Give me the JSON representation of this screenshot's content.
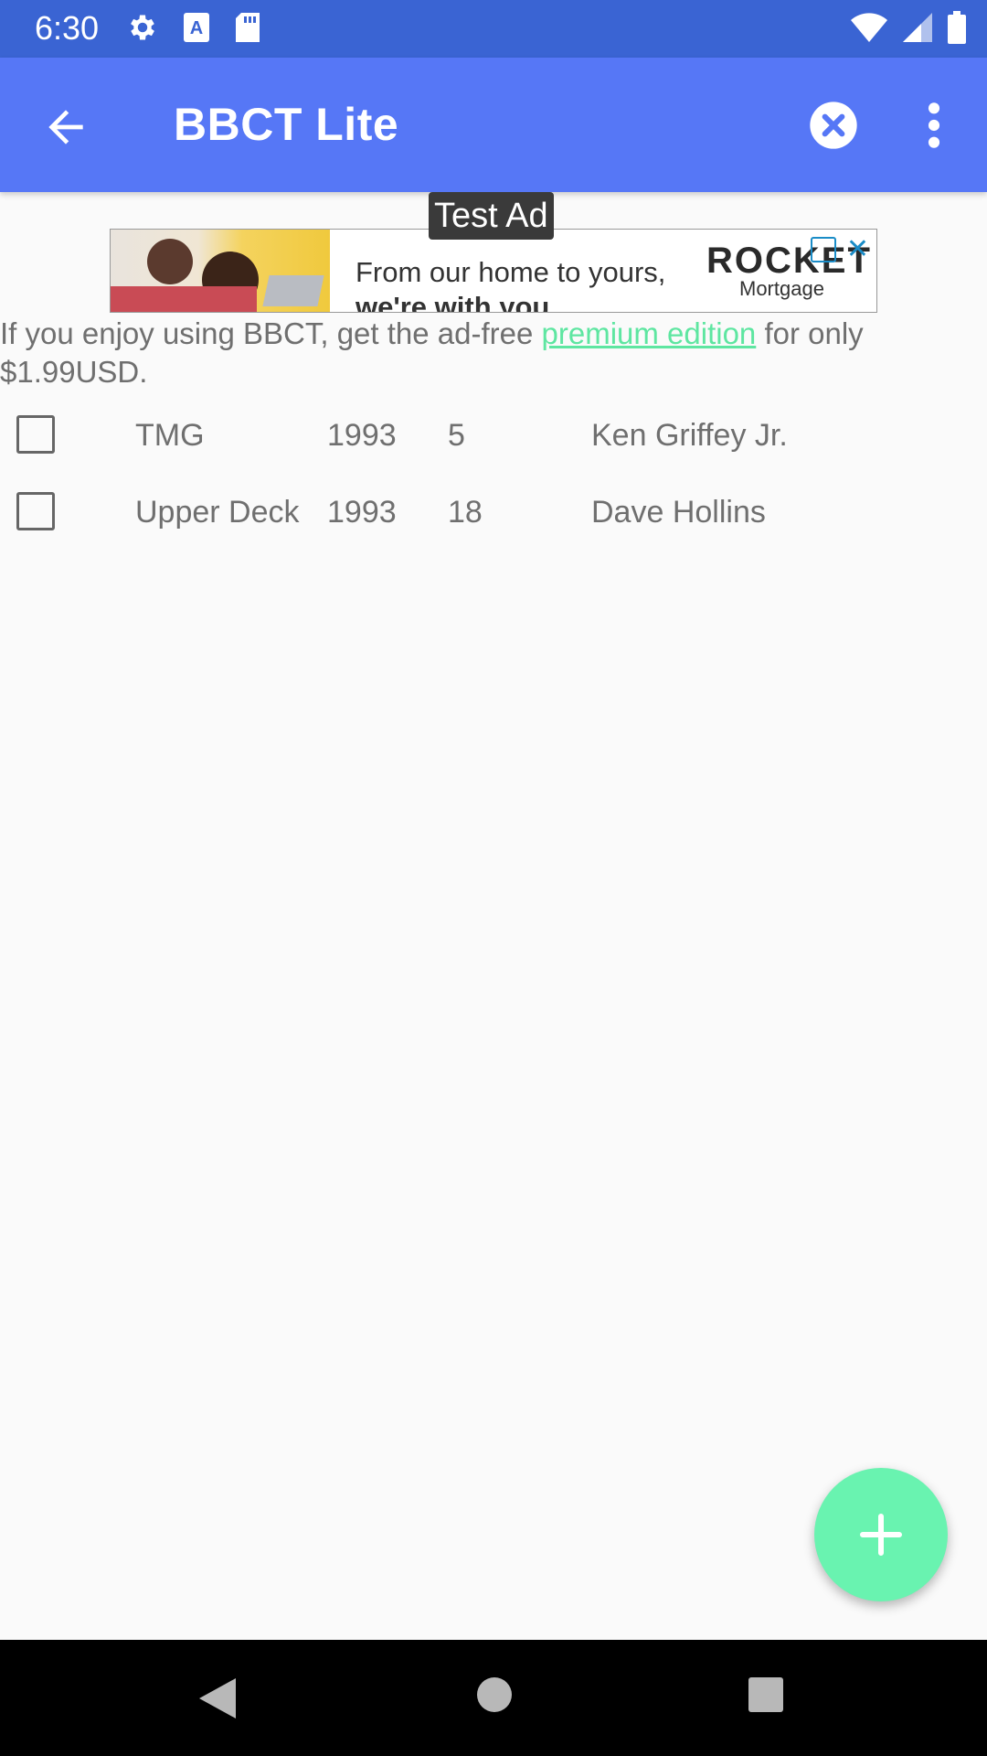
{
  "status_bar": {
    "time": "6:30",
    "icons_left": [
      "gear-icon",
      "a-icon",
      "sd-card-icon"
    ],
    "icons_right": [
      "wifi-icon",
      "signal-icon",
      "battery-icon"
    ]
  },
  "app_bar": {
    "title": "BBCT Lite",
    "back_icon": "arrow-left-icon",
    "clear_icon": "close-circle-icon",
    "more_icon": "more-vert-icon",
    "color": "#5677f6"
  },
  "ad": {
    "label": "Test Ad",
    "headline_line1": "From our home to yours,",
    "headline_line2": "we're with you.",
    "brand": "ROCKET",
    "brand_sub": "Mortgage"
  },
  "promo": {
    "prefix": "If you enjoy using BBCT, get the ad-free ",
    "link_text": "premium edition",
    "suffix": " for only $1.99USD.",
    "link_color": "#5ee6a1"
  },
  "cards": [
    {
      "brand": "TMG",
      "year": "1993",
      "number": "5",
      "player": "Ken Griffey Jr."
    },
    {
      "brand": "Upper Deck",
      "year": "1993",
      "number": "18",
      "player": "Dave Hollins"
    }
  ],
  "fab": {
    "icon": "plus-icon",
    "color": "#69f3b0"
  },
  "nav": {
    "icons": [
      "nav-back-icon",
      "nav-home-icon",
      "nav-recents-icon"
    ]
  }
}
